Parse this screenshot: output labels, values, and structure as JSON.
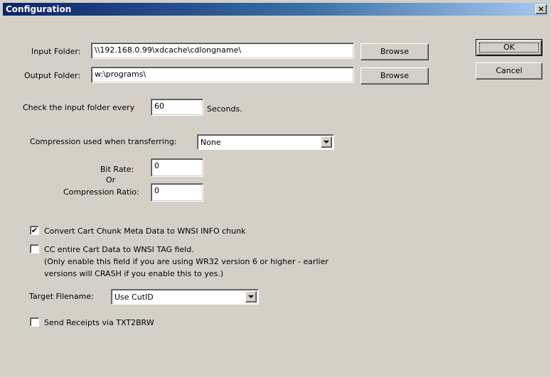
{
  "window": {
    "title": "Configuration",
    "close_glyph": "×"
  },
  "input_folder": {
    "label": "Input Folder:",
    "value": "\\\\192.168.0.99\\xdcache\\cdlongname\\",
    "browse_label": "Browse"
  },
  "output_folder": {
    "label": "Output Folder:",
    "value": "w:\\programs\\",
    "browse_label": "Browse"
  },
  "buttons": {
    "ok_label": "OK",
    "cancel_label": "Cancel"
  },
  "check_interval": {
    "prefix": "Check the input folder every",
    "value": "60",
    "suffix": "Seconds."
  },
  "compression": {
    "label": "Compression used when transferring:",
    "selected": "None"
  },
  "bit_rate": {
    "label": "Bit Rate:",
    "value": "0"
  },
  "or_label": "Or",
  "compression_ratio": {
    "label": "Compression Ratio:",
    "value": "0"
  },
  "options": {
    "convert_cart_chunk": {
      "label": "Convert Cart Chunk Meta Data to WNSI INFO chunk",
      "checked": true,
      "check_glyph": "✔"
    },
    "cc_entire_cart": {
      "label": "CC entire Cart Data to WNSI TAG field.",
      "note_line1": "(Only enable this field if you are using WR32 version 6 or higher - earlier",
      "note_line2": "versions will CRASH if you enable this to yes.)",
      "checked": false
    },
    "send_receipts": {
      "label": "Send Receipts via TXT2BRW",
      "checked": false
    }
  },
  "target_filename": {
    "label": "Target Filename:",
    "selected": "Use CutID"
  }
}
